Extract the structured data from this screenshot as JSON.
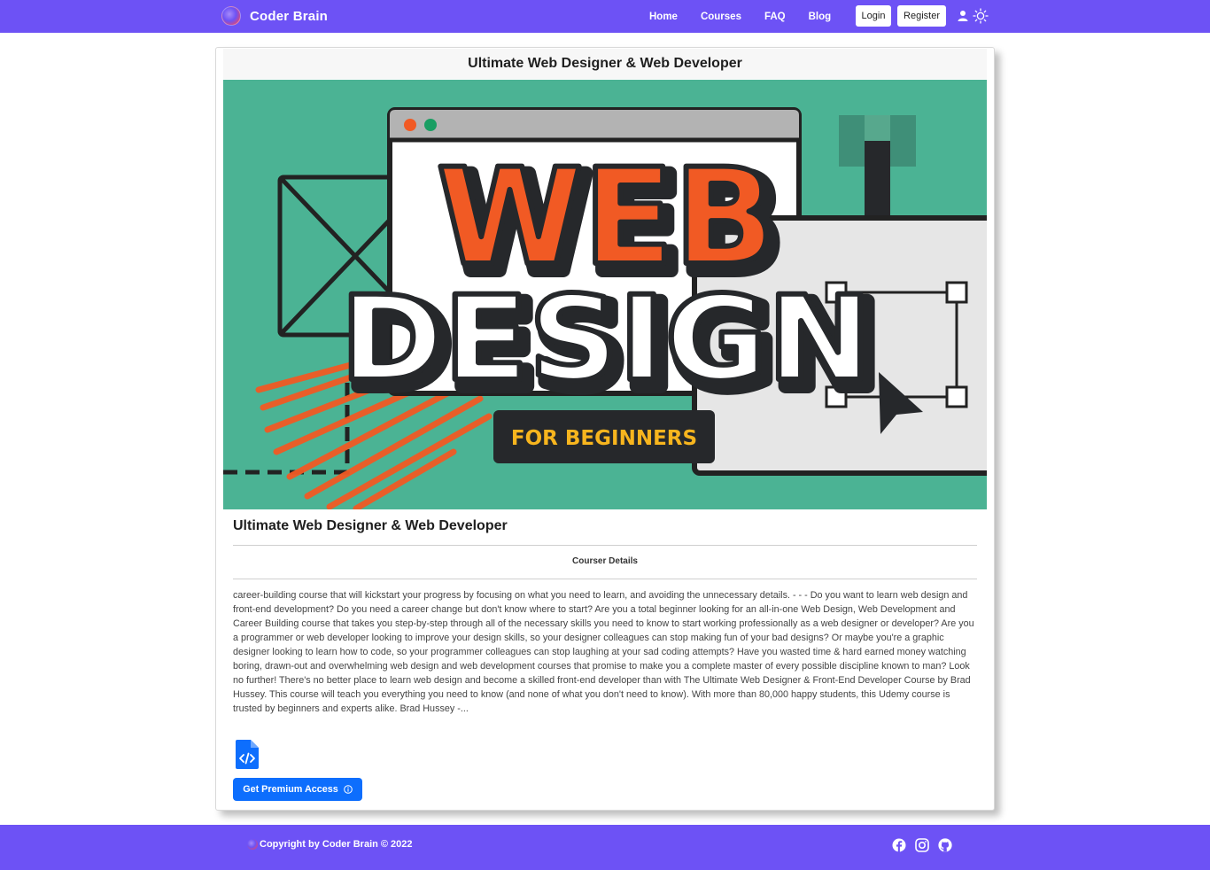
{
  "navbar": {
    "brand_name": "Coder Brain",
    "links": [
      "Home",
      "Courses",
      "FAQ",
      "Blog"
    ],
    "login_label": "Login",
    "register_label": "Register",
    "color": "#6d52f5"
  },
  "course": {
    "header_title": "Ultimate Web Designer & Web Developer",
    "banner": {
      "line1": "WEB",
      "line2": "DESIGN",
      "tagline": "FOR BEGINNERS",
      "colors": {
        "background": "#4bb394",
        "accent": "#f15a24",
        "tag_text": "#f7b51e"
      }
    },
    "title": "Ultimate Web Designer & Web Developer",
    "details_label": "Courser Details",
    "description": "career-building course that will kickstart your progress by focusing on what you need to learn, and avoiding the unnecessary details. - - - Do you want to learn web design and front-end development? Do you need a career change but don't know where to start? Are you a total beginner looking for an all-in-one Web Design, Web Development and Career Building course that takes you step-by-step through all of the necessary skills you need to know to start working professionally as a web designer or developer? Are you a programmer or web developer looking to improve your design skills, so your designer colleagues can stop making fun of your bad designs? Or maybe you're a graphic designer looking to learn how to code, so your programmer colleagues can stop laughing at your sad coding attempts? Have you wasted time & hard earned money watching boring, drawn-out and overwhelming web design and web development courses that promise to make you a complete master of every possible discipline known to man? Look no further! There's no better place to learn web design and become a skilled front-end developer than with The Ultimate Web Designer & Front-End Developer Course by Brad Hussey. This course will teach you everything you need to know (and none of what you don't need to know). With more than 80,000 happy students, this Udemy course is trusted by beginners and experts alike. Brad Hussey -...",
    "premium_button_label": "Get Premium Access",
    "button_color": "#0d6efd"
  },
  "footer": {
    "copyright": "Copyright by Coder Brain © 2022",
    "social_icons": [
      "facebook-icon",
      "instagram-icon",
      "github-icon"
    ]
  }
}
